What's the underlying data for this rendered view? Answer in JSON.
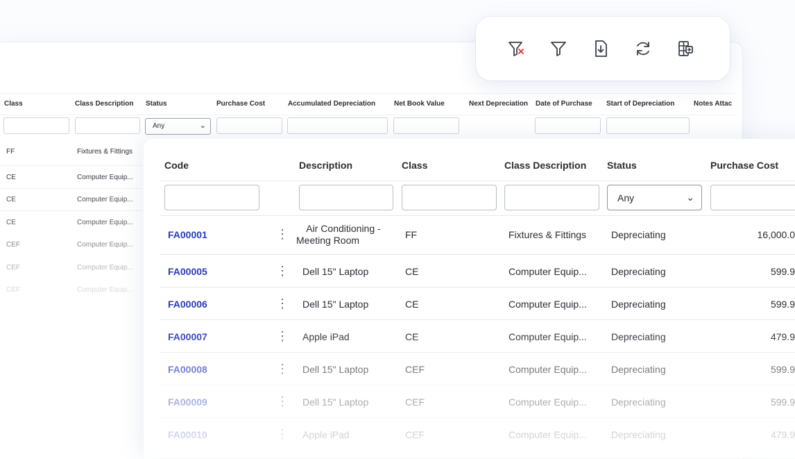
{
  "back_table": {
    "headers": [
      "Class",
      "Class Description",
      "Status",
      "Purchase Cost",
      "Accumulated Depreciation",
      "Net Book Value",
      "Next Depreciation",
      "Date of Purchase",
      "Start of Depreciation",
      "Notes Attac"
    ],
    "status_filter": "Any",
    "rows": [
      {
        "class": "FF",
        "class_description": "Fixtures & Fittings"
      },
      {
        "class": "CE",
        "class_description": "Computer Equip..."
      },
      {
        "class": "CE",
        "class_description": "Computer Equip..."
      },
      {
        "class": "CE",
        "class_description": "Computer Equip..."
      },
      {
        "class": "CEF",
        "class_description": "Computer Equip..."
      },
      {
        "class": "CEF",
        "class_description": "Computer Equip..."
      },
      {
        "class": "CEF",
        "class_description": "Computer Equip..."
      }
    ]
  },
  "toolbar": {
    "icons": [
      "clear-filter-icon",
      "filter-icon",
      "export-icon",
      "refresh-icon",
      "columns-icon"
    ]
  },
  "front_table": {
    "headers": {
      "code": "Code",
      "description": "Description",
      "class": "Class",
      "class_description": "Class Description",
      "status": "Status",
      "purchase_cost": "Purchase Cost"
    },
    "status_filter": "Any",
    "rows": [
      {
        "code": "FA00001",
        "description_line1": "Air Conditioning -",
        "description_line2": "Meeting Room",
        "class": "FF",
        "class_description": "Fixtures & Fittings",
        "status": "Depreciating",
        "purchase_cost": "16,000.0"
      },
      {
        "code": "FA00005",
        "description_line1": "Dell 15\" Laptop",
        "description_line2": "",
        "class": "CE",
        "class_description": "Computer Equip...",
        "status": "Depreciating",
        "purchase_cost": "599.9"
      },
      {
        "code": "FA00006",
        "description_line1": "Dell 15\" Laptop",
        "description_line2": "",
        "class": "CE",
        "class_description": "Computer Equip...",
        "status": "Depreciating",
        "purchase_cost": "599.9"
      },
      {
        "code": "FA00007",
        "description_line1": "Apple iPad",
        "description_line2": "",
        "class": "CE",
        "class_description": "Computer Equip...",
        "status": "Depreciating",
        "purchase_cost": "479.9"
      },
      {
        "code": "FA00008",
        "description_line1": "Dell 15\" Laptop",
        "description_line2": "",
        "class": "CEF",
        "class_description": "Computer Equip...",
        "status": "Depreciating",
        "purchase_cost": "599.9"
      },
      {
        "code": "FA00009",
        "description_line1": "Dell 15\" Laptop",
        "description_line2": "",
        "class": "CEF",
        "class_description": "Computer Equip...",
        "status": "Depreciating",
        "purchase_cost": "599.9"
      },
      {
        "code": "FA00010",
        "description_line1": "Apple iPad",
        "description_line2": "",
        "class": "CEF",
        "class_description": "Computer Equip...",
        "status": "Depreciating",
        "purchase_cost": "479.9"
      }
    ]
  },
  "colors": {
    "code_link": "#2a3bb5",
    "filter_clear_x": "#e0322b",
    "icon_stroke": "#3a3f4a"
  }
}
